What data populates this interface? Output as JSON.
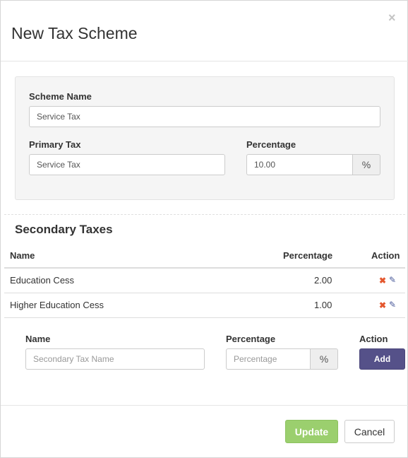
{
  "dialog": {
    "title": "New Tax Scheme",
    "close_glyph": "×"
  },
  "scheme": {
    "name_label": "Scheme Name",
    "name_value": "Service Tax",
    "primary_label": "Primary Tax",
    "primary_value": "Service Tax",
    "percentage_label": "Percentage",
    "percentage_value": "10.00",
    "percent_addon": "%"
  },
  "secondary": {
    "title": "Secondary Taxes",
    "columns": {
      "name": "Name",
      "percentage": "Percentage",
      "action": "Action"
    },
    "rows": [
      {
        "name": "Education Cess",
        "percentage": "2.00"
      },
      {
        "name": "Higher Education Cess",
        "percentage": "1.00"
      }
    ],
    "delete_glyph": "✖",
    "edit_glyph": "✎"
  },
  "new_row": {
    "name_label": "Name",
    "name_placeholder": "Secondary Tax Name",
    "percentage_label": "Percentage",
    "percentage_placeholder": "Percentage",
    "percent_addon": "%",
    "action_label": "Action",
    "add_button": "Add"
  },
  "footer": {
    "update_button": "Update",
    "cancel_button": "Cancel"
  },
  "colors": {
    "primary_button": "#555189",
    "update_button": "#9bcf6e",
    "delete_icon": "#e4572e",
    "edit_icon": "#4a5a9a"
  }
}
